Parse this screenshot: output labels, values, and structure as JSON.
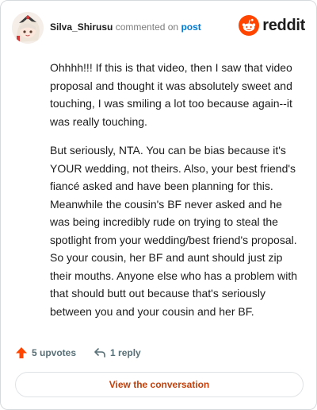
{
  "header": {
    "username": "Silva_Shirusu",
    "commented_text": "commented on",
    "post_link": "post",
    "logo_text": "reddit"
  },
  "comment": {
    "paragraphs": [
      "Ohhhh!!! If this is that video, then I saw that video proposal and thought it was absolutely sweet and touching, I was smiling a lot too because again--it was really touching.",
      "But seriously, NTA. You can be bias because it's YOUR wedding, not theirs. Also, your best friend's fiancé asked and have been planning for this. Meanwhile the cousin's BF never asked and he was being incredibly rude on trying to steal the spotlight from your wedding/best friend's proposal. So your cousin, her BF and aunt should just zip their mouths. Anyone else who has a problem with that should butt out because that's seriously between you and your cousin and her BF."
    ]
  },
  "actions": {
    "upvotes": "5 upvotes",
    "replies": "1 reply",
    "upvote_icon": "arrow-up-icon",
    "reply_icon": "reply-arrow-icon"
  },
  "cta": {
    "label": "View the conversation"
  },
  "colors": {
    "reddit_orange": "#ff4500",
    "link_blue": "#0079d3",
    "cta_text": "#c2410c",
    "muted": "#7c7c7c"
  }
}
